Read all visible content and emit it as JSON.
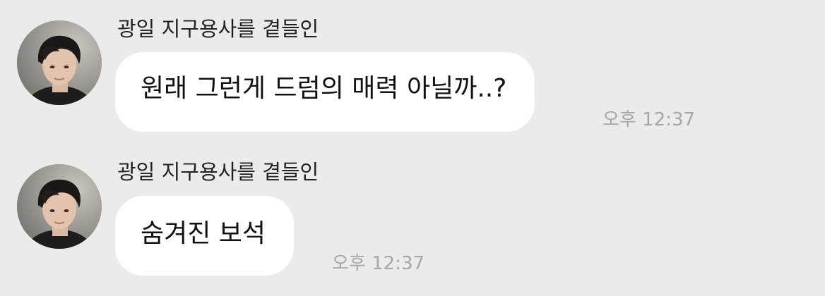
{
  "colors": {
    "background": "#ebebeb",
    "bubble": "#ffffff",
    "sender_text": "#222222",
    "message_text": "#111111",
    "timestamp": "#a6a6a6"
  },
  "messages": [
    {
      "sender": "광일 지구용사를 곁들인",
      "avatar_icon": "profile-photo",
      "text": "원래 그런게 드럼의 매력 아닐까..?",
      "time": "오후 12:37"
    },
    {
      "sender": "광일 지구용사를 곁들인",
      "avatar_icon": "profile-photo",
      "text": "숨겨진 보석",
      "time": "오후 12:37"
    }
  ]
}
